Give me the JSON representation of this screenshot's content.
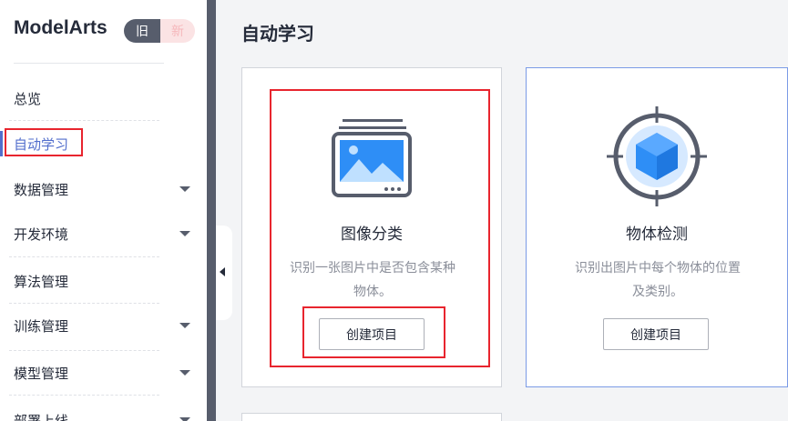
{
  "sidebar": {
    "brand": "ModelArts",
    "version_old": "旧",
    "version_new": "新",
    "items": [
      {
        "label": "总览",
        "has_caret": false
      },
      {
        "label": "自动学习",
        "has_caret": false,
        "active": true
      },
      {
        "label": "数据管理",
        "has_caret": true
      },
      {
        "label": "开发环境",
        "has_caret": true
      },
      {
        "label": "算法管理",
        "has_caret": false
      },
      {
        "label": "训练管理",
        "has_caret": true
      },
      {
        "label": "模型管理",
        "has_caret": true
      },
      {
        "label": "部署上线",
        "has_caret": true
      }
    ]
  },
  "main": {
    "title": "自动学习",
    "cards": [
      {
        "title": "图像分类",
        "desc_line1": "识别一张图片中是否包含某种",
        "desc_line2": "物体。",
        "button": "创建项目",
        "icon": "image-classification-icon"
      },
      {
        "title": "物体检测",
        "desc_line1": "识别出图片中每个物体的位置",
        "desc_line2": "及类别。",
        "button": "创建项目",
        "icon": "object-detection-icon"
      }
    ]
  },
  "colors": {
    "accent": "#526ecc",
    "highlight_red": "#e8252e",
    "sidebar_dark": "#575d6c",
    "icon_blue": "#2e8ef6"
  }
}
